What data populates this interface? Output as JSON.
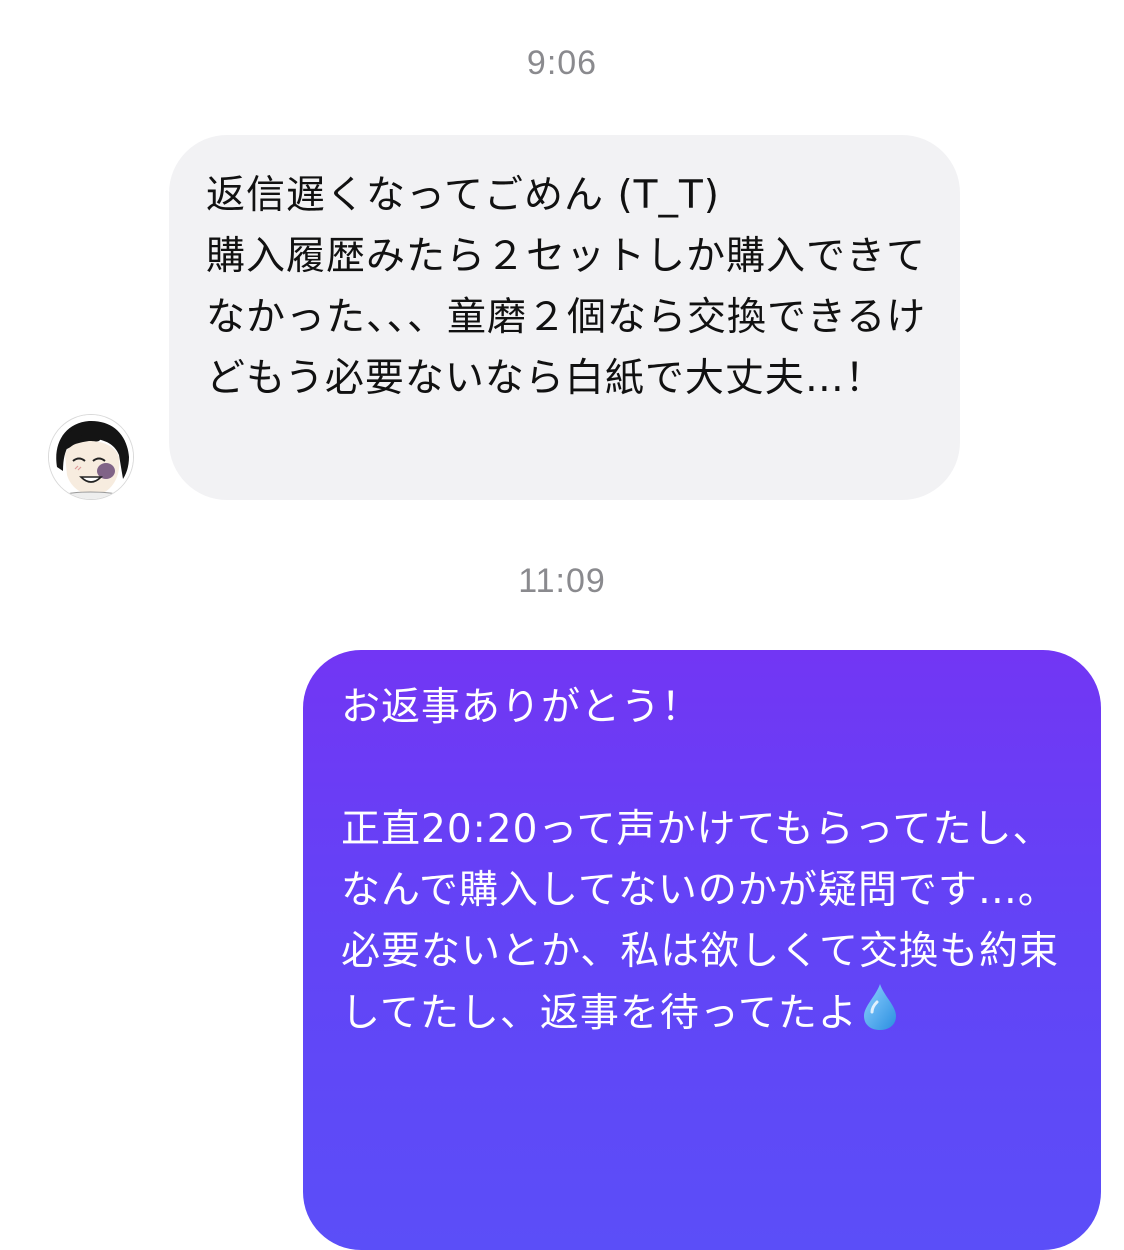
{
  "thread": {
    "timestamps": [
      "9:06",
      "11:09"
    ]
  },
  "messages": [
    {
      "sender": "other",
      "avatar_icon": "anime-character-avatar-icon",
      "text": "返信遅くなってごめん (T_T)\n購入履歴みたら２セットしか購入できてなかった、、、童磨２個なら交換できるけどもう必要ないなら白紙で大丈夫…！"
    },
    {
      "sender": "me",
      "text_main": "お返事ありがとう！\n\n正直20:20って声かけてもらってたし、なんで購入してないのかが疑問です…。必要ないとか、私は欲しくて交換も約束してたし、返事を待ってたよ",
      "emoji_icon": "droplet-icon"
    }
  ],
  "colors": {
    "incoming_bubble": "#f2f2f4",
    "outgoing_gradient_top": "#7236f4",
    "outgoing_gradient_bottom": "#5b4ef8",
    "timestamp_text": "#8a8a8e",
    "droplet": "#4aa8f0"
  }
}
